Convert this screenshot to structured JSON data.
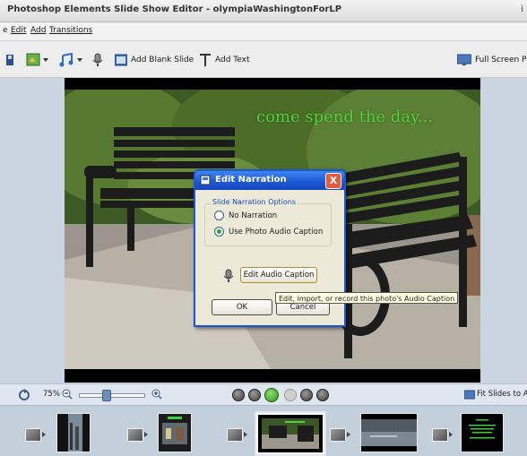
{
  "window": {
    "title": "Photoshop Elements Slide Show Editor - olympiaWashingtonForLP",
    "title_cut": "i"
  },
  "menu": {
    "items": [
      "e",
      "Edit",
      "Add",
      "Transitions"
    ]
  },
  "toolbar": {
    "add_blank_slide": "Add Blank Slide",
    "add_text": "Add Text",
    "full_screen_preview": "Full Screen Pre"
  },
  "slide": {
    "caption_text": "come spend the day..."
  },
  "dialog": {
    "title": "Edit Narration",
    "close_label": "X",
    "group_label": "Slide Narration Options",
    "options": [
      "No Narration",
      "Use Photo Audio Caption"
    ],
    "selected_option": "Use Photo Audio Caption",
    "edit_audio_caption": "Edit Audio Caption",
    "ok": "OK",
    "cancel": "Cancel"
  },
  "tooltip": {
    "text": "Edit, import, or record this photo's Audio Caption"
  },
  "controls": {
    "zoom_label": "75%",
    "fit_slides": "Fit Slides to A"
  },
  "filmstrip": {
    "selected_index": 2
  }
}
